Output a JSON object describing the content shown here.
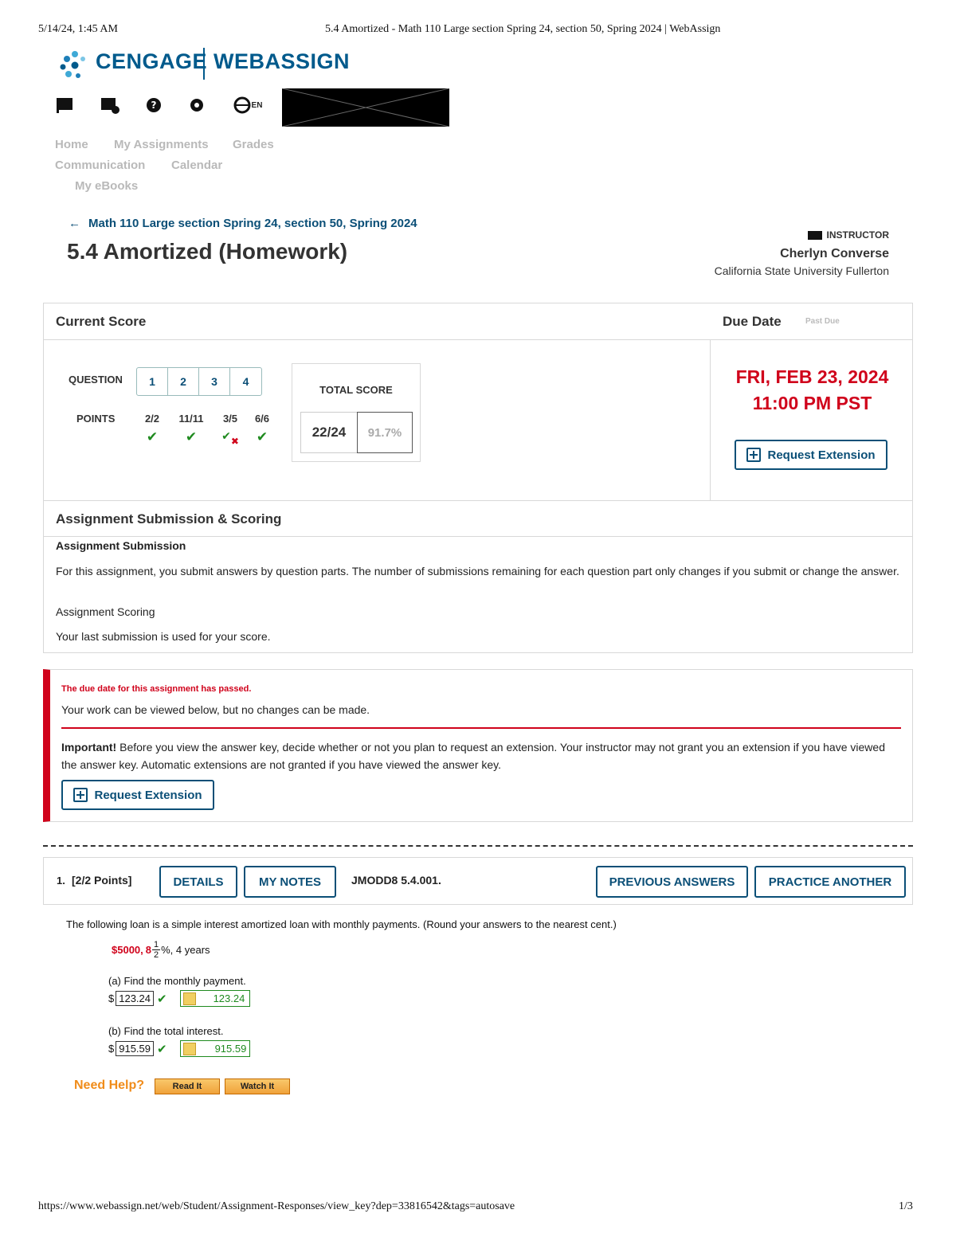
{
  "print_header": {
    "date": "5/14/24, 1:45 AM",
    "title": "5.4 Amortized - Math 110 Large section Spring 24, section 50, Spring 2024 | WebAssign"
  },
  "print_footer": {
    "url": "https://www.webassign.net/web/Student/Assignment-Responses/view_key?dep=33816542&tags=autosave",
    "page": "1/3"
  },
  "logo": {
    "brand": "CENGAGE",
    "product": "WEBASSIGN",
    "color": "#005a8c"
  },
  "top_icons": [
    "flag-icon",
    "message-icon",
    "help-icon",
    "settings-icon",
    "globe-language-icon"
  ],
  "language": "EN",
  "nav": {
    "home": "Home",
    "my_assignments": "My Assignments",
    "grades": "Grades",
    "communication": "Communication",
    "calendar": "Calendar",
    "my_ebooks": "My eBooks"
  },
  "breadcrumb": "Math 110 Large section Spring 24, section 50, Spring 2024",
  "page_title": "5.4 Amortized (Homework)",
  "instructor": {
    "label": "INSTRUCTOR",
    "name": "Cherlyn Converse",
    "school": "California State University Fullerton"
  },
  "score": {
    "current_score_label": "Current Score",
    "due_date_label": "Due Date",
    "due_status": "Past Due",
    "question_label": "QUESTION",
    "points_label": "POINTS",
    "questions": [
      {
        "num": "1",
        "points": "2/2",
        "status": "correct"
      },
      {
        "num": "2",
        "points": "11/11",
        "status": "correct"
      },
      {
        "num": "3",
        "points": "3/5",
        "status": "partial"
      },
      {
        "num": "4",
        "points": "6/6",
        "status": "correct"
      }
    ],
    "total_label": "TOTAL SCORE",
    "total": "22/24",
    "percent": "91.7%",
    "due_day": "FRI, FEB 23, 2024",
    "due_time": "11:00 PM PST",
    "request_extension": "Request Extension"
  },
  "submission": {
    "heading": "Assignment Submission & Scoring",
    "sub_heading": "Assignment Submission",
    "sub_text": "For this assignment, you submit answers by question parts. The number of submissions remaining for each question part only changes if you submit or change the answer.",
    "scoring_heading": "Assignment Scoring",
    "scoring_text": "Your last submission is used for your score."
  },
  "alert": {
    "title": "The due date for this assignment has passed.",
    "text": "Your work can be viewed below, but no changes can be made.",
    "important_label": "Important!",
    "important_text": " Before you view the answer key, decide whether or not you plan to request an extension. Your instructor may not grant you an extension if you have viewed the answer key. Automatic extensions are not granted if you have viewed the answer key.",
    "button": "Request Extension"
  },
  "question1": {
    "number": "1.",
    "points": "[2/2 Points]",
    "details": "DETAILS",
    "my_notes": "MY NOTES",
    "code": "JMODD8 5.4.001.",
    "previous_answers": "PREVIOUS ANSWERS",
    "practice_another": "PRACTICE ANOTHER",
    "prompt": "The following loan is a simple interest amortized loan with monthly payments. (Round your answers to the nearest cent.)",
    "loan_amount": "$5000,",
    "rate_whole": "8",
    "rate_num": "1",
    "rate_den": "2",
    "rate_suffix": "%, 4 years",
    "part_a": "(a) Find the monthly payment.",
    "answer_a": "123.24",
    "key_a": "123.24",
    "part_b": "(b) Find the total interest.",
    "answer_b": "915.59",
    "key_b": "915.59",
    "currency": "$",
    "need_help": "Need Help?",
    "read_it": "Read It",
    "watch_it": "Watch It"
  }
}
